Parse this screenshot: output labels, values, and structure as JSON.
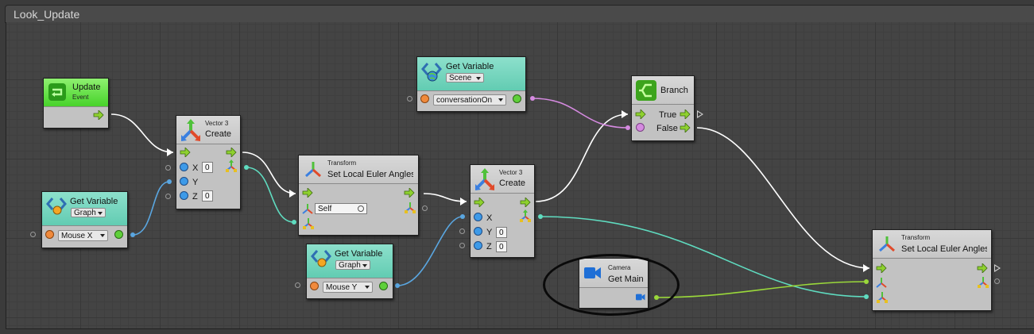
{
  "graph": {
    "title": "Look_Update"
  },
  "nodes": {
    "update": {
      "title": "Update",
      "subtitle": "Event"
    },
    "get_var_mouse_x": {
      "title": "Get Variable",
      "scope": "Graph",
      "variable": "Mouse X"
    },
    "vector3_create_1": {
      "category": "Vector 3",
      "title": "Create",
      "x_label": "X",
      "x_value": "0",
      "y_label": "Y",
      "z_label": "Z",
      "z_value": "0"
    },
    "transform_1": {
      "category": "Transform",
      "title": "Set Local Euler Angles",
      "target": "Self"
    },
    "get_var_conversation": {
      "title": "Get Variable",
      "scope": "Scene",
      "variable": "conversationOn"
    },
    "branch": {
      "title": "Branch",
      "true_label": "True",
      "false_label": "False"
    },
    "vector3_create_2": {
      "category": "Vector 3",
      "title": "Create",
      "x_label": "X",
      "y_label": "Y",
      "y_value": "0",
      "z_label": "Z",
      "z_value": "0"
    },
    "get_var_mouse_y": {
      "title": "Get Variable",
      "scope": "Graph",
      "variable": "Mouse Y"
    },
    "camera": {
      "category": "Camera",
      "title": "Get Main"
    },
    "transform_2": {
      "category": "Transform",
      "title": "Set Local Euler Angles"
    }
  },
  "colors": {
    "flow_port": "#8fd12f",
    "vector_wire": "#5fdcc0",
    "float_wire": "#5aa6e0",
    "bool_wire": "#d58ae0",
    "camera_wire": "#9ad83a",
    "flow_wire": "#ffffff"
  }
}
